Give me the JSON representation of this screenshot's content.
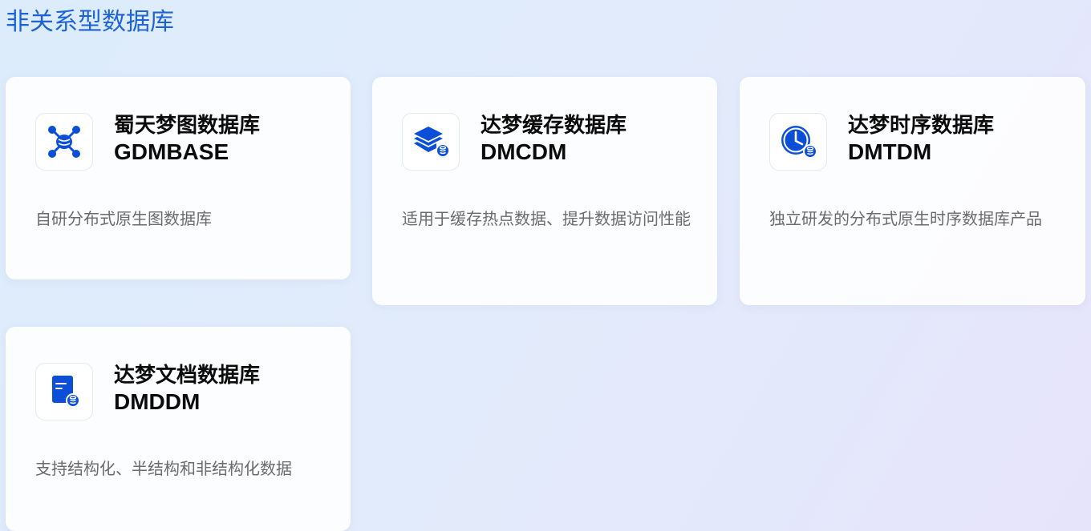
{
  "section": {
    "title": "非关系型数据库"
  },
  "cards": [
    {
      "title": "蜀天梦图数据库",
      "code": "GDMBASE",
      "desc": "自研分布式原生图数据库",
      "icon": "graph-network-icon"
    },
    {
      "title": "达梦缓存数据库",
      "code": "DMCDM",
      "desc": "适用于缓存热点数据、提升数据访问性能",
      "icon": "stack-database-icon"
    },
    {
      "title": "达梦时序数据库",
      "code": "DMTDM",
      "desc": "独立研发的分布式原生时序数据库产品",
      "icon": "clock-database-icon"
    },
    {
      "title": "达梦文档数据库",
      "code": "DMDDM",
      "desc": "支持结构化、半结构和非结构化数据",
      "icon": "document-database-icon"
    }
  ],
  "colors": {
    "accent": "#1d63d6",
    "icon": "#0a4fd6"
  }
}
